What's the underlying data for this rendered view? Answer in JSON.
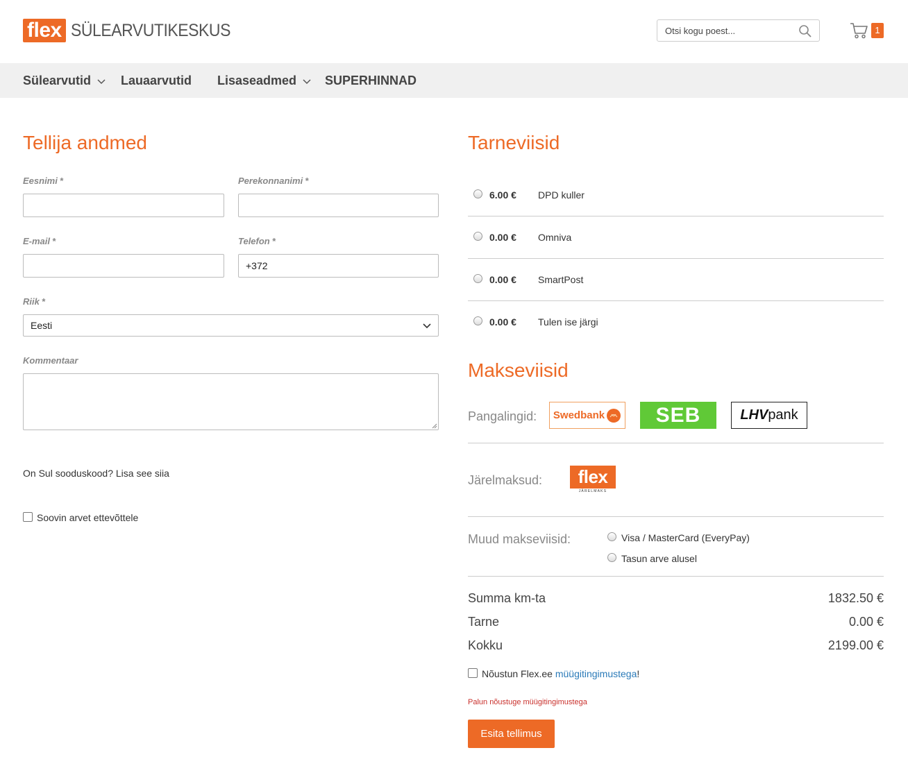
{
  "header": {
    "logo_mark": "flex",
    "logo_text": "SÜLEARVUTIKESKUS",
    "search_placeholder": "Otsi kogu poest...",
    "cart_count": "1"
  },
  "nav": {
    "items": [
      "Sülearvutid",
      "Lauaarvutid",
      "Lisaseadmed",
      "SUPERHINNAD"
    ]
  },
  "customer": {
    "title": "Tellija andmed",
    "first_name_label": "Eesnimi",
    "last_name_label": "Perekonnanimi",
    "email_label": "E-mail",
    "phone_label": "Telefon",
    "phone_value": "+372",
    "country_label": "Riik",
    "country_value": "Eesti",
    "comment_label": "Kommentaar",
    "required_mark": "*",
    "promo_text": "On Sul sooduskood? Lisa see siia",
    "company_invoice_label": "Soovin arvet ettevõttele"
  },
  "delivery": {
    "title": "Tarneviisid",
    "options": [
      {
        "price": "6.00 €",
        "name": "DPD kuller"
      },
      {
        "price": "0.00 €",
        "name": "Omniva"
      },
      {
        "price": "0.00 €",
        "name": "SmartPost"
      },
      {
        "price": "0.00 €",
        "name": "Tulen ise järgi"
      }
    ]
  },
  "payment": {
    "title": "Makseviisid",
    "banklinks_label": "Pangalingid:",
    "banks": [
      "Swedbank",
      "SEB",
      "LHV",
      "pank"
    ],
    "installments_label": "Järelmaksud:",
    "installment_logo": "flex",
    "installment_logo_sub": "JÄRELMAKS",
    "other_label": "Muud makseviisid:",
    "other_options": [
      "Visa / MasterCard (EveryPay)",
      "Tasun arve alusel"
    ]
  },
  "summary": {
    "rows": [
      {
        "label": "Summa km-ta",
        "value": "1832.50 €"
      },
      {
        "label": "Tarne",
        "value": "0.00 €"
      },
      {
        "label": "Kokku",
        "value": "2199.00 €"
      }
    ],
    "terms_prefix": "Nõustun Flex.ee ",
    "terms_link": "müügitingimustega",
    "terms_suffix": "!",
    "error": "Palun nõustuge müügitingimustega",
    "submit_label": "Esita tellimus"
  },
  "colors": {
    "accent": "#ed6a26",
    "nav_bg": "#f0f0f0",
    "link": "#2a7ab8",
    "error": "#c9302c",
    "seb_green": "#60c937"
  }
}
